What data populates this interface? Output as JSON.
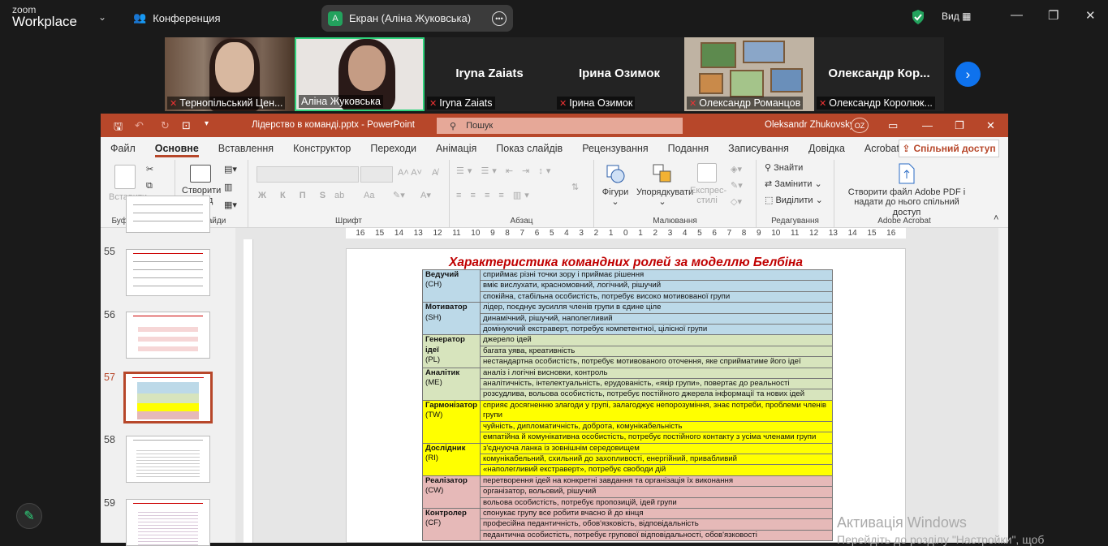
{
  "zoom": {
    "logo_small": "zoom",
    "logo_big": "Workplace",
    "meeting_label": "Конференция",
    "share_avatar": "А",
    "share_label": "Екран (Аліна Жуковська)",
    "view_label": "Вид",
    "participants": [
      {
        "name": "Тернопільський Цен...",
        "video": true
      },
      {
        "name": "Аліна Жуковська",
        "video": true,
        "active": true
      },
      {
        "name": "Iryna Zaiats",
        "video": false
      },
      {
        "name": "Ірина Озимок",
        "video": false
      },
      {
        "name": "Олександр Романцов",
        "video": true
      },
      {
        "name": "Олександр Королюк...",
        "display": "Олександр Кор...",
        "video": false
      }
    ]
  },
  "powerpoint": {
    "file_title": "Лідерство в команді.pptx - PowerPoint",
    "search_placeholder": "Пошук",
    "user": "Oleksandr Zhukovsky",
    "user_initials": "OZ",
    "tabs": [
      "Файл",
      "Основне",
      "Вставлення",
      "Конструктор",
      "Переходи",
      "Анімація",
      "Показ слайдів",
      "Рецензування",
      "Подання",
      "Записування",
      "Довідка",
      "Acrobat"
    ],
    "active_tab": "Основне",
    "share_button": "Спільний доступ",
    "ribbon": {
      "paste": "Вставити",
      "create_slide": "Створити слайд",
      "groups": [
        "Буфер обміну",
        "Слайди",
        "Шрифт",
        "Абзац",
        "Малювання",
        "Редагування",
        "Adobe Acrobat"
      ],
      "shapes": "Фігури",
      "arrange": "Упорядкувати",
      "express_styles": "Експрес-стилі",
      "find": "Знайти",
      "replace": "Замінити",
      "select": "Виділити",
      "acrobat_line1": "Створити файл Adobe PDF і",
      "acrobat_line2": "надати до нього спільний доступ",
      "font_tools": "Ж К П S",
      "font_aa": "Aa"
    },
    "ruler_ticks": [
      "16",
      "15",
      "14",
      "13",
      "12",
      "11",
      "10",
      "9",
      "8",
      "7",
      "6",
      "5",
      "4",
      "3",
      "2",
      "1",
      "0",
      "1",
      "2",
      "3",
      "4",
      "5",
      "6",
      "7",
      "8",
      "9",
      "10",
      "11",
      "12",
      "13",
      "14",
      "15",
      "16"
    ],
    "thumbnails": [
      {
        "num": "55"
      },
      {
        "num": "56"
      },
      {
        "num": "57",
        "selected": true
      },
      {
        "num": "58"
      },
      {
        "num": "59"
      }
    ]
  },
  "slide": {
    "title": "Характеристика командних ролей за моделлю Белбіна",
    "roles": [
      {
        "name": "Ведучий",
        "code": "(CH)",
        "color": "#bcd9e8",
        "items": [
          "сприймає різні точки зору і приймає рішення",
          "вміє вислухати, красномовний, логічний, рішучий",
          "спокійна, стабільна особистість, потребує високо мотивованої групи"
        ]
      },
      {
        "name": "Мотиватор",
        "code": "(SH)",
        "color": "#bcd9e8",
        "items": [
          "лідер, поєднує зусилля членів групи в єдине ціле",
          "динамічний, рішучий, наполегливий",
          "домінуючий екстраверт, потребує компетентної, цілісної групи"
        ]
      },
      {
        "name": "Генератор ідеї",
        "code": "(PL)",
        "color": "#d7e4bd",
        "items": [
          "джерело ідей",
          "багата уява, креативність",
          "нестандартна особистість, потребує мотивованого оточення, яке сприйматиме його ідеї"
        ]
      },
      {
        "name": "Аналітик",
        "code": "(ME)",
        "color": "#d7e4bd",
        "items": [
          "аналіз і логічні висновки, контроль",
          "аналітичність, інтелектуальність, ерудованість, «якір групи», повертає до реальності",
          "розсудлива, вольова особистість, потребує постійного джерела інформації та нових ідей"
        ]
      },
      {
        "name": "Гармонізатор",
        "code": "(TW)",
        "color": "#ffff00",
        "items": [
          "сприяє досягненню злагоди у групі, залагоджує непорозуміння, знає потреби, проблеми членів групи",
          "чуйність, дипломатичність, доброта, комунікабельність",
          "емпатійна й комунікативна особистість, потребує постійного контакту з усіма членами групи"
        ]
      },
      {
        "name": "Дослідник",
        "code": "(RI)",
        "color": "#ffff00",
        "items": [
          "з'єднуюча ланка із зовнішнім середовищем",
          "комунікабельний, схильний до захопливості, енергійний, привабливий",
          "«наполегливий екстраверт», потребує свободи дій"
        ]
      },
      {
        "name": "Реалізатор",
        "code": "(CW)",
        "color": "#e6b9b8",
        "items": [
          "перетворення ідей на конкретні завдання та організація їх виконання",
          "організатор, вольовий, рішучий",
          "вольова особистість, потребує пропозицій, ідей групи"
        ]
      },
      {
        "name": "Контролер",
        "code": "(CF)",
        "color": "#e6b9b8",
        "items": [
          "спонукає групу все робити вчасно й до кінця",
          "професійна педантичність, обов'язковість, відповідальність",
          "педантична особистість, потребує групової відповідальності, обов'язковості"
        ]
      }
    ]
  },
  "windows": {
    "watermark": "Активація Windows",
    "watermark_sub": "Перейдіть до розділу \"Настройки\", щоб"
  }
}
